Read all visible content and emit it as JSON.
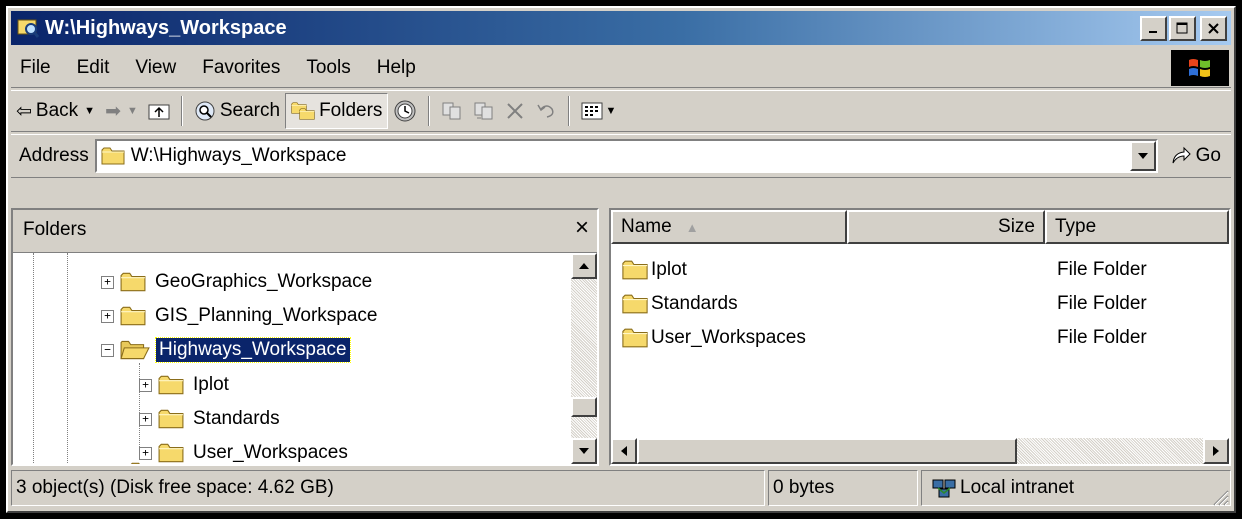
{
  "window": {
    "title": "W:\\Highways_Workspace",
    "icon": "folder-explore-icon",
    "controls": [
      "minimize",
      "maximize",
      "close"
    ]
  },
  "menu": [
    "File",
    "Edit",
    "View",
    "Favorites",
    "Tools",
    "Help"
  ],
  "toolbar": {
    "back_label": "Back",
    "search_label": "Search",
    "folders_label": "Folders",
    "folders_pressed": true
  },
  "address": {
    "label": "Address",
    "value": "W:\\Highways_Workspace",
    "go_label": "Go"
  },
  "folders_pane": {
    "title": "Folders",
    "close_glyph": "×",
    "tree": [
      {
        "label": "GeoGraphics_Workspace",
        "expander": "+",
        "selected": false
      },
      {
        "label": "GIS_Planning_Workspace",
        "expander": "+",
        "selected": false
      },
      {
        "label": "Highways_Workspace",
        "expander": "−",
        "selected": true,
        "open": true
      },
      {
        "label": "Iplot",
        "expander": "+",
        "selected": false
      },
      {
        "label": "Standards",
        "expander": "+",
        "selected": false
      },
      {
        "label": "User_Workspaces",
        "expander": "+",
        "selected": false
      }
    ]
  },
  "file_list": {
    "columns": {
      "name": "Name",
      "size": "Size",
      "type": "Type"
    },
    "sort_column": "Name",
    "rows": [
      {
        "name": "Iplot",
        "size": "",
        "type": "File Folder"
      },
      {
        "name": "Standards",
        "size": "",
        "type": "File Folder"
      },
      {
        "name": "User_Workspaces",
        "size": "",
        "type": "File Folder"
      }
    ]
  },
  "status": {
    "objects": "3 object(s) (Disk free space: 4.62 GB)",
    "size": "0 bytes",
    "zone": "Local intranet"
  },
  "colors": {
    "title_start": "#0a246a",
    "title_end": "#a6caf0",
    "selection": "#0a246a",
    "face": "#d4d0c8",
    "folder": "#f6d96b"
  }
}
